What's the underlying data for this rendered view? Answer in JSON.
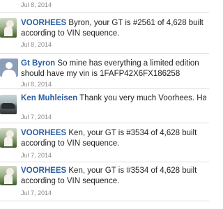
{
  "top_timestamp": "Jul 8, 2014",
  "posts": [
    {
      "author": "VOORHEES",
      "message": "Byron, your GT is #2561 of 4,628 built according to VIN sequence.",
      "date": "Jul 8, 2014",
      "avatar": "user-photo"
    },
    {
      "author": "Gt Byron",
      "message": "So mine has everything a limited edition should have my vin is 1FAFP42X6FX186258",
      "date": "Jul 8, 2014",
      "avatar": "default-user-icon"
    },
    {
      "author": "Ken Muhleisen",
      "message": "Thank you very much Voorhees. Have a great day.",
      "date": "Jul 7, 2014",
      "avatar": "user-photo"
    },
    {
      "author": "VOORHEES",
      "message": "Ken, your GT is #3534 of 4,628 built according to VIN sequence.",
      "date": "Jul 7, 2014",
      "avatar": "user-photo"
    },
    {
      "author": "VOORHEES",
      "message": "Ken, your GT is #3534 of 4,628 built according to VIN sequence.",
      "date": "Jul 7, 2014",
      "avatar": "user-photo"
    }
  ]
}
